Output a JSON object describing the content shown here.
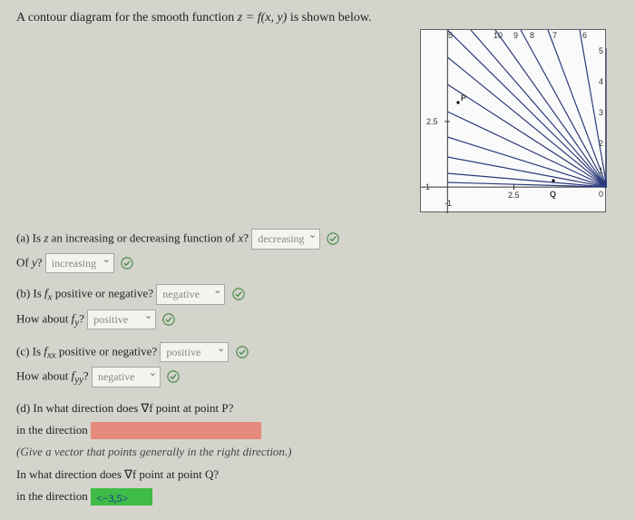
{
  "prompt": {
    "text_before": "A contour diagram for the smooth function ",
    "equation": "z = f(x, y)",
    "text_after": " is shown below."
  },
  "parts": {
    "a": {
      "q1_before": "(a) Is ",
      "q1_var": "z",
      "q1_after": " an increasing or decreasing function of ",
      "q1_var2": "x",
      "q1_end": "?",
      "a1": "decreasing",
      "q2_before": "Of ",
      "q2_var": "y",
      "q2_end": "?",
      "a2": "increasing"
    },
    "b": {
      "q1_before": "(b) Is ",
      "q1_sym": "fₓ",
      "q1_after": " positive or negative?",
      "a1": "negative",
      "q2_before": "How about ",
      "q2_sym": "f_y",
      "q2_end": "?",
      "a2": "positive"
    },
    "c": {
      "q1_before": "(c) Is ",
      "q1_sym": "fₓₓ",
      "q1_after": " positive or negative?",
      "a1": "positive",
      "q2_before": "How about ",
      "q2_sym": "f_yy",
      "q2_end": "?",
      "a2": "negative"
    },
    "d": {
      "q1": "(d) In what direction does ∇f point at point P?",
      "dir_label": "in the direction",
      "hint": "(Give a vector that points generally in the right direction.)",
      "q2": "In what direction does ∇f point at point Q?",
      "a2": "<−3,5>"
    }
  },
  "chart_data": {
    "type": "contour",
    "xlim": [
      -1,
      6
    ],
    "ylim": [
      -1,
      6
    ],
    "xticks": [
      -1,
      2.5
    ],
    "yticks": [
      -1,
      2.5
    ],
    "contour_labels": [
      5,
      6,
      7,
      8,
      9,
      10
    ],
    "edge_labels_top": [
      "5",
      "10",
      "9",
      "8",
      "7",
      "6"
    ],
    "edge_labels_right": [
      "5",
      "4",
      "3",
      "2",
      "1",
      "0"
    ],
    "points": [
      {
        "name": "P",
        "x": 0.4,
        "y": 3.2
      },
      {
        "name": "Q",
        "x": 4.0,
        "y": 0.25
      }
    ],
    "axis_tick_2_5_x": "2.5",
    "axis_tick_2_5_y": "2.5",
    "neg1_x": "-1",
    "neg1_y": "-1"
  }
}
